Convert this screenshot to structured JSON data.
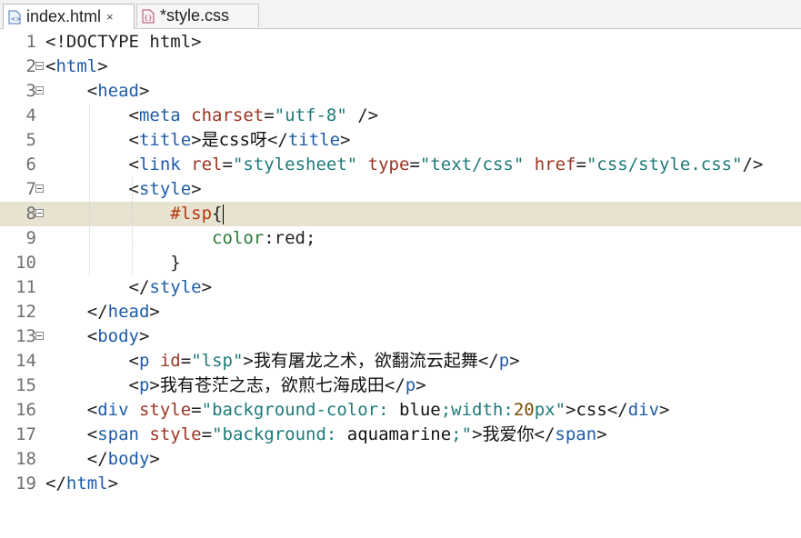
{
  "tabs": [
    {
      "label": "index.html",
      "close": "×",
      "icon": "html-file-icon"
    },
    {
      "label": "*style.css",
      "icon": "css-file-icon"
    }
  ],
  "lines": [
    {
      "n": "1",
      "parts": [
        [
          "br",
          "<!DOCTYPE html>"
        ]
      ]
    },
    {
      "n": "2",
      "parts": [
        [
          "br",
          "<"
        ],
        [
          "tg",
          "html"
        ],
        [
          "br",
          ">"
        ]
      ]
    },
    {
      "n": "3",
      "parts": [
        [
          "br",
          "    <"
        ],
        [
          "tg",
          "head"
        ],
        [
          "br",
          ">"
        ]
      ]
    },
    {
      "n": "4",
      "parts": [
        [
          "br",
          "        <"
        ],
        [
          "tg",
          "meta "
        ],
        [
          "at",
          "charset"
        ],
        [
          "br",
          "="
        ],
        [
          "vl",
          "\"utf-8\""
        ],
        [
          "br",
          " />"
        ]
      ]
    },
    {
      "n": "5",
      "parts": [
        [
          "br",
          "        <"
        ],
        [
          "tg",
          "title"
        ],
        [
          "br",
          ">"
        ],
        [
          "tx",
          "是css呀"
        ],
        [
          "br",
          "</"
        ],
        [
          "tg",
          "title"
        ],
        [
          "br",
          ">"
        ]
      ]
    },
    {
      "n": "6",
      "parts": [
        [
          "br",
          "        <"
        ],
        [
          "tg",
          "link "
        ],
        [
          "at",
          "rel"
        ],
        [
          "br",
          "="
        ],
        [
          "vl",
          "\"stylesheet\""
        ],
        [
          "br",
          " "
        ],
        [
          "at",
          "type"
        ],
        [
          "br",
          "="
        ],
        [
          "vl",
          "\"text/css\""
        ],
        [
          "br",
          " "
        ],
        [
          "at",
          "href"
        ],
        [
          "br",
          "="
        ],
        [
          "vl",
          "\"css/style.css\""
        ],
        [
          "br",
          "/>"
        ]
      ]
    },
    {
      "n": "7",
      "parts": [
        [
          "br",
          "        <"
        ],
        [
          "tg",
          "style"
        ],
        [
          "br",
          ">"
        ]
      ]
    },
    {
      "n": "8",
      "parts": [
        [
          "br",
          "            "
        ],
        [
          "sel",
          "#lsp"
        ],
        [
          "br",
          "{"
        ]
      ]
    },
    {
      "n": "9",
      "parts": [
        [
          "br",
          "                "
        ],
        [
          "prop",
          "color"
        ],
        [
          "br",
          ":red;"
        ]
      ]
    },
    {
      "n": "10",
      "parts": [
        [
          "br",
          "            }"
        ]
      ]
    },
    {
      "n": "11",
      "parts": [
        [
          "br",
          "        </"
        ],
        [
          "tg",
          "style"
        ],
        [
          "br",
          ">"
        ]
      ]
    },
    {
      "n": "12",
      "parts": [
        [
          "br",
          "    </"
        ],
        [
          "tg",
          "head"
        ],
        [
          "br",
          ">"
        ]
      ]
    },
    {
      "n": "13",
      "parts": [
        [
          "br",
          "    <"
        ],
        [
          "tg",
          "body"
        ],
        [
          "br",
          ">"
        ]
      ]
    },
    {
      "n": "14",
      "parts": [
        [
          "br",
          "        <"
        ],
        [
          "tg",
          "p "
        ],
        [
          "at",
          "id"
        ],
        [
          "br",
          "="
        ],
        [
          "vl",
          "\"lsp\""
        ],
        [
          "br",
          ">"
        ],
        [
          "tx",
          "我有屠龙之术，欲翻流云起舞"
        ],
        [
          "br",
          "</"
        ],
        [
          "tg",
          "p"
        ],
        [
          "br",
          ">"
        ]
      ]
    },
    {
      "n": "15",
      "parts": [
        [
          "br",
          "        <"
        ],
        [
          "tg",
          "p"
        ],
        [
          "br",
          ">"
        ],
        [
          "tx",
          "我有苍茫之志，欲煎七海成田"
        ],
        [
          "br",
          "</"
        ],
        [
          "tg",
          "p"
        ],
        [
          "br",
          ">"
        ]
      ]
    },
    {
      "n": "16",
      "parts": [
        [
          "br",
          "    <"
        ],
        [
          "tg",
          "div "
        ],
        [
          "at",
          "style"
        ],
        [
          "br",
          "="
        ],
        [
          "vl",
          "\"background-color: "
        ],
        [
          "tx",
          "blue"
        ],
        [
          "vl",
          ";width:"
        ],
        [
          "num",
          "20"
        ],
        [
          "vl",
          "px\""
        ],
        [
          "br",
          ">"
        ],
        [
          "tx",
          "css"
        ],
        [
          "br",
          "</"
        ],
        [
          "tg",
          "div"
        ],
        [
          "br",
          ">"
        ]
      ]
    },
    {
      "n": "17",
      "parts": [
        [
          "br",
          "    <"
        ],
        [
          "tg",
          "span "
        ],
        [
          "at",
          "style"
        ],
        [
          "br",
          "="
        ],
        [
          "vl",
          "\"background: "
        ],
        [
          "tx",
          "aquamarine"
        ],
        [
          "vl",
          ";\""
        ],
        [
          "br",
          ">"
        ],
        [
          "tx",
          "我爱你"
        ],
        [
          "br",
          "</"
        ],
        [
          "tg",
          "span"
        ],
        [
          "br",
          ">"
        ]
      ]
    },
    {
      "n": "18",
      "parts": [
        [
          "br",
          "    </"
        ],
        [
          "tg",
          "body"
        ],
        [
          "br",
          ">"
        ]
      ]
    },
    {
      "n": "19",
      "parts": [
        [
          "br",
          "</"
        ],
        [
          "tg",
          "html"
        ],
        [
          "br",
          ">"
        ]
      ]
    }
  ],
  "fold_lines": [
    "2",
    "3",
    "7",
    "8",
    "13"
  ],
  "current_line": "8",
  "colors": {
    "tag": "#1f5ca8",
    "attr": "#9b3424",
    "value": "#1f7a7a",
    "current_line_bg": "#e8e2d1"
  }
}
